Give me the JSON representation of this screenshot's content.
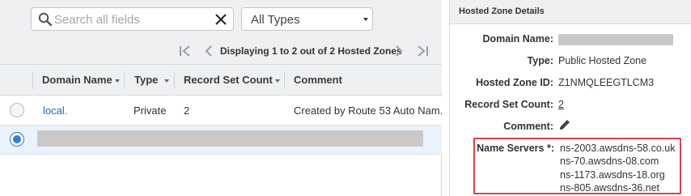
{
  "search": {
    "placeholder": "Search all fields",
    "value": ""
  },
  "type_filter": {
    "selected": "All Types"
  },
  "pager": {
    "text": "Displaying 1 to 2 out of 2 Hosted Zones"
  },
  "table": {
    "columns": [
      "Domain Name",
      "Type",
      "Record Set Count",
      "Comment"
    ],
    "rows": [
      {
        "domain_name": "local.",
        "type": "Private",
        "record_set_count": "2",
        "comment": "Created by Route 53 Auto Nam...",
        "selected": false
      },
      {
        "domain_name": "",
        "type": "",
        "record_set_count": "",
        "comment": "",
        "selected": true,
        "redacted": true
      }
    ]
  },
  "details": {
    "title": "Hosted Zone Details",
    "domain_name_label": "Domain Name:",
    "domain_name_value": "",
    "type_label": "Type:",
    "type_value": "Public Hosted Zone",
    "hosted_zone_id_label": "Hosted Zone ID:",
    "hosted_zone_id_value": "Z1NMQLEEGTLCM3",
    "record_set_count_label": "Record Set Count:",
    "record_set_count_value": "2",
    "comment_label": "Comment:",
    "name_servers_label": "Name Servers *:",
    "name_servers": [
      "ns-2003.awsdns-58.co.uk",
      "ns-70.awsdns-08.com",
      "ns-1173.awsdns-18.org",
      "ns-805.awsdns-36.net"
    ]
  },
  "colors": {
    "link": "#1f66b3",
    "highlight_border": "#d9434a",
    "selected_row": "#eaf2fb",
    "radio_selected": "#2f7fd8"
  },
  "icons": {
    "search": "search-icon",
    "clear": "close-icon",
    "first_page": "first-page-icon",
    "prev_page": "prev-page-icon",
    "next_page": "next-page-icon",
    "last_page": "last-page-icon",
    "edit": "pencil-icon"
  }
}
